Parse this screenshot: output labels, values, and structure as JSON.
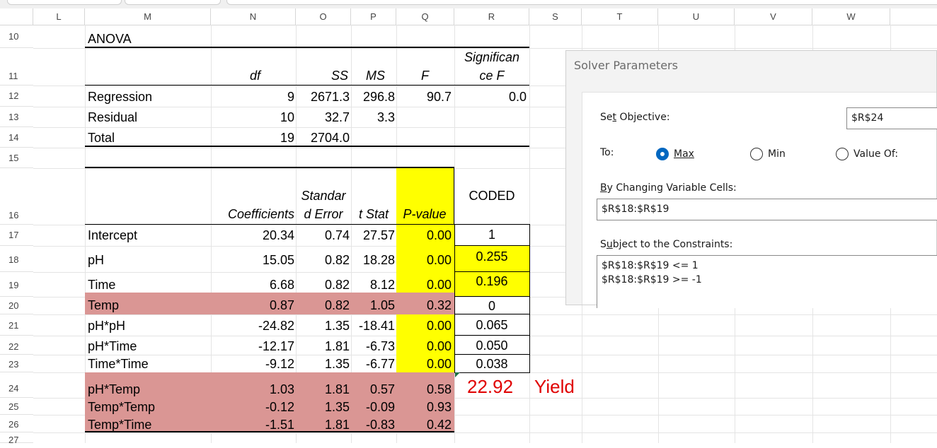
{
  "columns": [
    "L",
    "M",
    "N",
    "O",
    "P",
    "Q",
    "R",
    "S",
    "T",
    "U",
    "V",
    "W"
  ],
  "rows": [
    "10",
    "11",
    "12",
    "13",
    "14",
    "15",
    "16",
    "17",
    "18",
    "19",
    "20",
    "21",
    "22",
    "23",
    "24",
    "25",
    "26",
    "27"
  ],
  "anova": {
    "title": "ANOVA",
    "headers": {
      "df": "df",
      "ss": "SS",
      "ms": "MS",
      "f": "F",
      "sigf_line1": "Significan",
      "sigf_line2": "ce F"
    },
    "rows": [
      {
        "label": "Regression",
        "df": "9",
        "ss": "2671.3",
        "ms": "296.8",
        "f": "90.7",
        "sigf": "0.0"
      },
      {
        "label": "Residual",
        "df": "10",
        "ss": "32.7",
        "ms": "3.3",
        "f": "",
        "sigf": ""
      },
      {
        "label": "Total",
        "df": "19",
        "ss": "2704.0",
        "ms": "",
        "f": "",
        "sigf": ""
      }
    ]
  },
  "coef_table": {
    "headers": {
      "coef": "Coefficients",
      "se_line1": "Standar",
      "se_line2": "d Error",
      "tstat": "t Stat",
      "pvalue": "P-value",
      "coded": "CODED"
    },
    "rows": [
      {
        "label": "Intercept",
        "coef": "20.34",
        "se": "0.74",
        "t": "27.57",
        "p": "0.00",
        "coded": "1"
      },
      {
        "label": "pH",
        "coef": "15.05",
        "se": "0.82",
        "t": "18.28",
        "p": "0.00",
        "coded": "0.255"
      },
      {
        "label": "Time",
        "coef": "6.68",
        "se": "0.82",
        "t": "8.12",
        "p": "0.00",
        "coded": "0.196"
      },
      {
        "label": "Temp",
        "coef": "0.87",
        "se": "0.82",
        "t": "1.05",
        "p": "0.32",
        "coded": "0"
      },
      {
        "label": "pH*pH",
        "coef": "-24.82",
        "se": "1.35",
        "t": "-18.41",
        "p": "0.00",
        "coded": "0.065"
      },
      {
        "label": "pH*Time",
        "coef": "-12.17",
        "se": "1.81",
        "t": "-6.73",
        "p": "0.00",
        "coded": "0.050"
      },
      {
        "label": "Time*Time",
        "coef": "-9.12",
        "se": "1.35",
        "t": "-6.77",
        "p": "0.00",
        "coded": "0.038"
      },
      {
        "label": "pH*Temp",
        "coef": "1.03",
        "se": "1.81",
        "t": "0.57",
        "p": "0.58",
        "coded": ""
      },
      {
        "label": "Temp*Temp",
        "coef": "-0.12",
        "se": "1.35",
        "t": "-0.09",
        "p": "0.93",
        "coded": ""
      },
      {
        "label": "Temp*Time",
        "coef": "-1.51",
        "se": "1.81",
        "t": "-0.83",
        "p": "0.42",
        "coded": ""
      }
    ]
  },
  "yield": {
    "value": "22.92",
    "label": "Yield"
  },
  "solver": {
    "title": "Solver Parameters",
    "set_objective_label": "Set Objective:",
    "set_objective_value": "$R$24",
    "to_label": "To:",
    "options": [
      "Max",
      "Min",
      "Value Of:"
    ],
    "selected": "Max",
    "changing_label": "By Changing Variable Cells:",
    "changing_value": "$R$18:$R$19",
    "constraints_label": "Subject to the Constraints:",
    "constraints": [
      "$R$18:$R$19 <= 1",
      "$R$18:$R$19 >= -1"
    ]
  },
  "colors": {
    "pink": "#da9694",
    "yellow": "#ffff00",
    "yield_red": "#e00000",
    "radio_blue": "#0067c0"
  }
}
